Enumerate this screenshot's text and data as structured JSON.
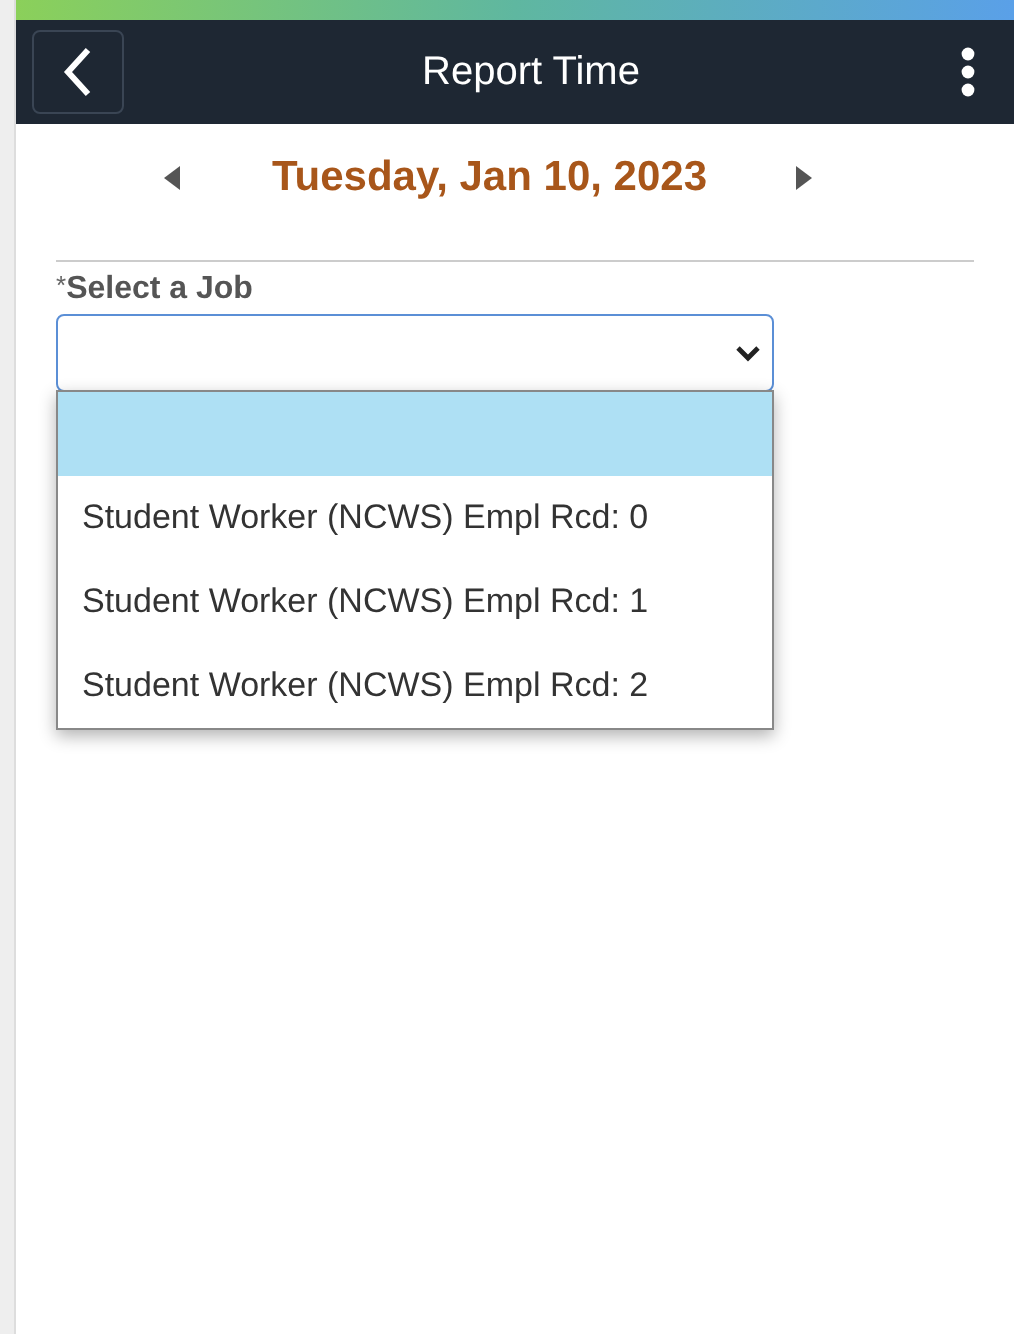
{
  "header": {
    "title": "Report Time"
  },
  "date_nav": {
    "date": "Tuesday, Jan 10, 2023"
  },
  "job_field": {
    "required_mark": "*",
    "label": "Select a Job",
    "expanded": true,
    "options": [
      {
        "selected": true
      },
      {
        "label": "Student Worker (NCWS) Empl Rcd: 0",
        "selected": false
      },
      {
        "label": "Student Worker (NCWS) Empl Rcd: 1",
        "selected": false
      },
      {
        "label": "Student Worker (NCWS) Empl Rcd: 2",
        "selected": false
      }
    ]
  }
}
